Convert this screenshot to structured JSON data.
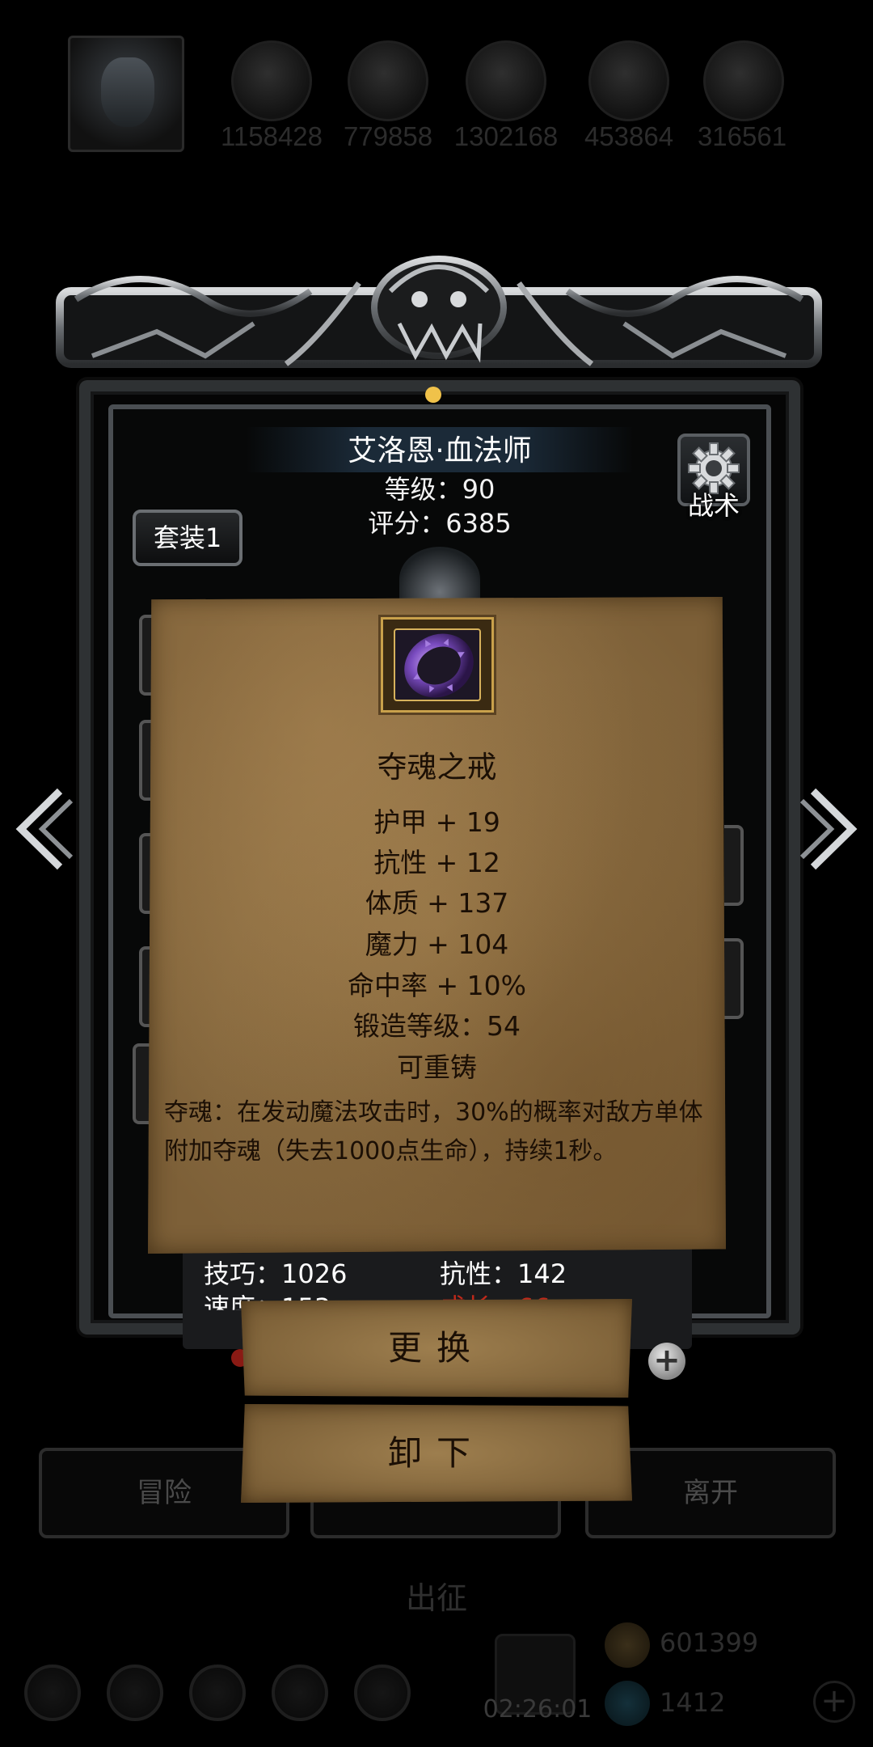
{
  "top_bar": {
    "resources": [
      {
        "icon": "hero-power-icon",
        "value": "1158428"
      },
      {
        "icon": "gold-bars-icon",
        "value": "779858"
      },
      {
        "icon": "iron-ingot-icon",
        "value": "1302168"
      },
      {
        "icon": "crystal-icon",
        "value": "453864"
      },
      {
        "icon": "wing-icon",
        "value": "316561"
      }
    ]
  },
  "hero": {
    "name": "艾洛恩·血法师",
    "level": "等级：90",
    "score": "评分：6385"
  },
  "buttons": {
    "tactics": "战术",
    "set": "套装1"
  },
  "item": {
    "name": "夺魂之戒",
    "icon": "purple-ring-icon",
    "stats": [
      "护甲 + 19",
      "抗性 + 12",
      "体质 + 137",
      "魔力 + 104",
      "命中率 + 10%",
      "锻造等级：54",
      "可重铸"
    ],
    "description": "夺魂：在发动魔法攻击时，30%的概率对敌方单体附加夺魂（失去1000点生命），持续1秒。"
  },
  "hero_stats": {
    "skill": "技巧：1026",
    "resistance": "抗性：142",
    "speed": "速度：153",
    "growth": "成长：66"
  },
  "actions": {
    "replace": "更换",
    "unequip": "卸下"
  },
  "bottom_nav": {
    "adventure": "冒险",
    "leave": "离开",
    "expedition": "出征",
    "timer": "02:26:01",
    "gold": "601399",
    "gems": "1412"
  },
  "colors": {
    "parchment": "#9c7c4c",
    "ink": "#1b0f05",
    "growth_red": "#c0281a"
  }
}
